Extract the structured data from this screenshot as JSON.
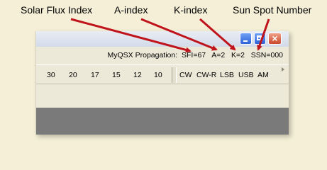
{
  "callouts": {
    "solar_flux": "Solar Flux Index",
    "a_index": "A-index",
    "k_index": "K-index",
    "ssn": "Sun Spot Number"
  },
  "window": {
    "close_glyph": "×",
    "status_text": "MyQSX Propagation:  SFI=67   A=2   K=2   SSN=000",
    "bands": [
      "30",
      "20",
      "17",
      "15",
      "12",
      "10"
    ],
    "modes": [
      "CW",
      "CW-R",
      "LSB",
      "USB",
      "AM"
    ]
  },
  "colors": {
    "background": "#f4efd6",
    "arrow": "#c0141c",
    "window_face": "#ece9d8",
    "pane": "#7a7a7a"
  }
}
